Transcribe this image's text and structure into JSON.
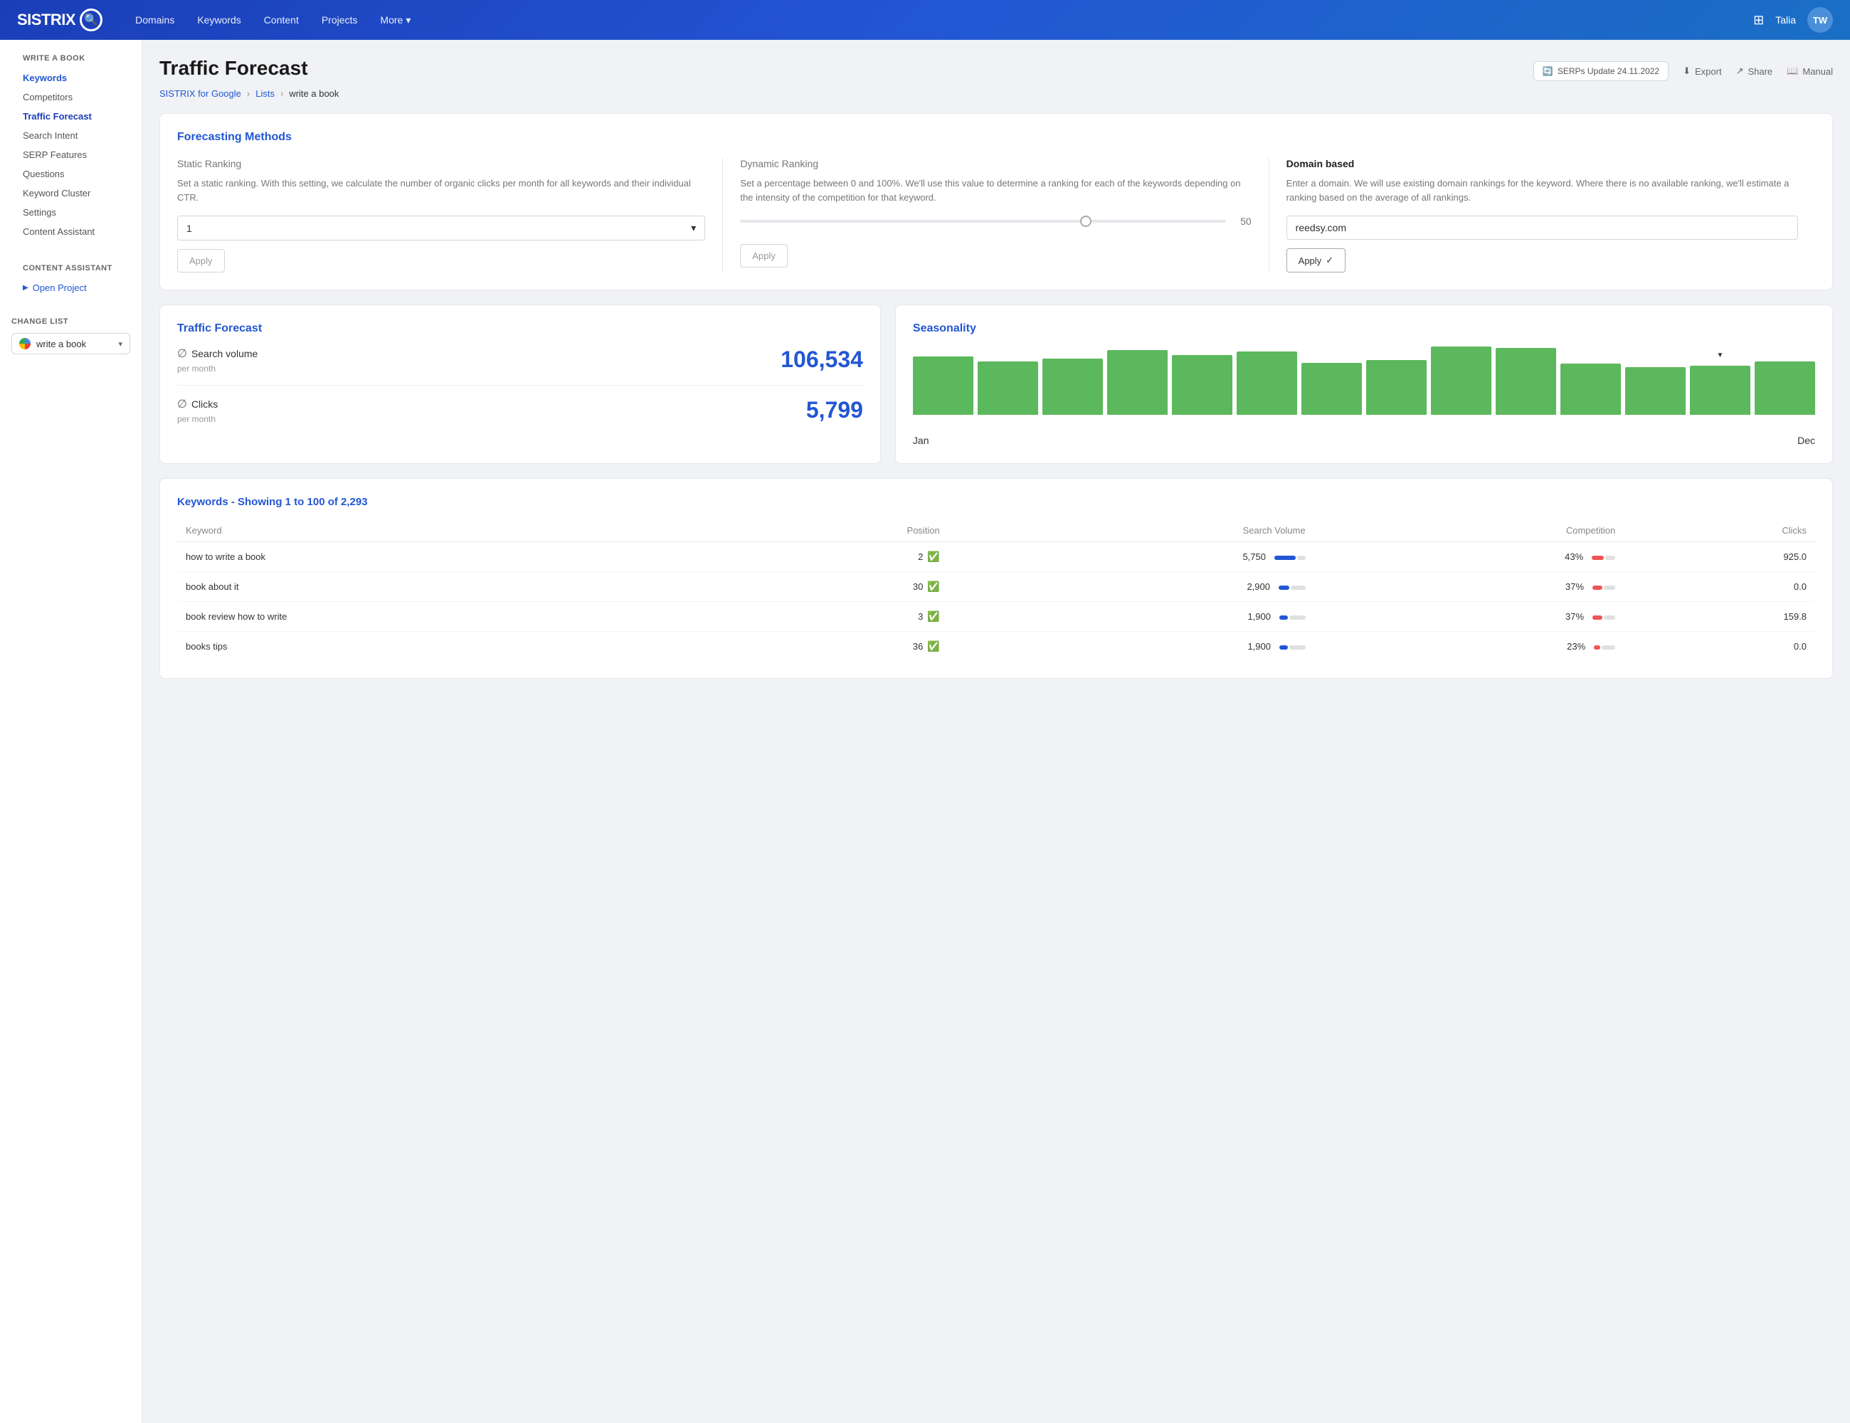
{
  "header": {
    "logo": "SISTRIX",
    "nav": [
      "Domains",
      "Keywords",
      "Content",
      "Projects",
      "More"
    ],
    "user": "Talia",
    "user_initials": "TW"
  },
  "sidebar": {
    "section_title": "WRITE A BOOK",
    "items": [
      {
        "label": "Keywords",
        "active": false,
        "link": true
      },
      {
        "label": "Competitors",
        "active": false
      },
      {
        "label": "Traffic Forecast",
        "active": true
      },
      {
        "label": "Search Intent",
        "active": false
      },
      {
        "label": "SERP Features",
        "active": false
      },
      {
        "label": "Questions",
        "active": false
      },
      {
        "label": "Keyword Cluster",
        "active": false
      },
      {
        "label": "Settings",
        "active": false
      },
      {
        "label": "Content Assistant",
        "active": false
      }
    ],
    "content_assistant_title": "CONTENT ASSISTANT",
    "open_project": "Open Project",
    "change_list_label": "CHANGE LIST",
    "change_list_value": "write a book"
  },
  "breadcrumb": {
    "parts": [
      "SISTRIX for Google",
      "Lists",
      "write a book"
    ]
  },
  "serps_update": "SERPs Update 24.11.2022",
  "actions": {
    "export": "Export",
    "share": "Share",
    "manual": "Manual"
  },
  "page_title": "Traffic Forecast",
  "forecasting": {
    "section_title": "Forecasting Methods",
    "static": {
      "title": "Static Ranking",
      "desc": "Set a static ranking. With this setting, we calculate the number of organic clicks per month for all keywords and their individual CTR.",
      "select_value": "1",
      "apply_label": "Apply"
    },
    "dynamic": {
      "title": "Dynamic Ranking",
      "desc": "Set a percentage between 0 and 100%. We'll use this value to determine a ranking for each of the keywords depending on the intensity of the competition for that keyword.",
      "slider_value": "50",
      "apply_label": "Apply"
    },
    "domain": {
      "title": "Domain based",
      "desc": "Enter a domain. We will use existing domain rankings for the keyword. Where there is no available ranking, we'll estimate a ranking based on the average of all rankings.",
      "domain_value": "reedsy.com",
      "apply_label": "Apply",
      "apply_check": "✓"
    }
  },
  "traffic_forecast": {
    "card_title": "Traffic Forecast",
    "search_volume_label": "Search volume",
    "search_volume_sub": "per month",
    "search_volume_value": "106,534",
    "clicks_label": "Clicks",
    "clicks_sub": "per month",
    "clicks_value": "5,799"
  },
  "seasonality": {
    "title": "Seasonality",
    "label_jan": "Jan",
    "label_dec": "Dec",
    "bars": [
      85,
      78,
      82,
      95,
      88,
      93,
      76,
      80,
      100,
      98,
      75,
      70,
      72,
      78
    ]
  },
  "keywords_table": {
    "title": "Keywords - Showing 1 to 100 of 2,293",
    "columns": [
      "Keyword",
      "Position",
      "Search Volume",
      "Competition",
      "Clicks"
    ],
    "rows": [
      {
        "keyword": "how to write a book",
        "position": 2,
        "check": true,
        "search_volume": "5,750",
        "sv_fill": 60,
        "competition": "43%",
        "comp_fill": 43,
        "clicks": "925.0"
      },
      {
        "keyword": "book about it",
        "position": 30,
        "check": true,
        "search_volume": "2,900",
        "sv_fill": 30,
        "competition": "37%",
        "comp_fill": 37,
        "clicks": "0.0"
      },
      {
        "keyword": "book review how to write",
        "position": 3,
        "check": true,
        "search_volume": "1,900",
        "sv_fill": 25,
        "competition": "37%",
        "comp_fill": 37,
        "clicks": "159.8"
      },
      {
        "keyword": "books tips",
        "position": 36,
        "check": true,
        "search_volume": "1,900",
        "sv_fill": 25,
        "competition": "23%",
        "comp_fill": 23,
        "clicks": "0.0"
      }
    ]
  }
}
